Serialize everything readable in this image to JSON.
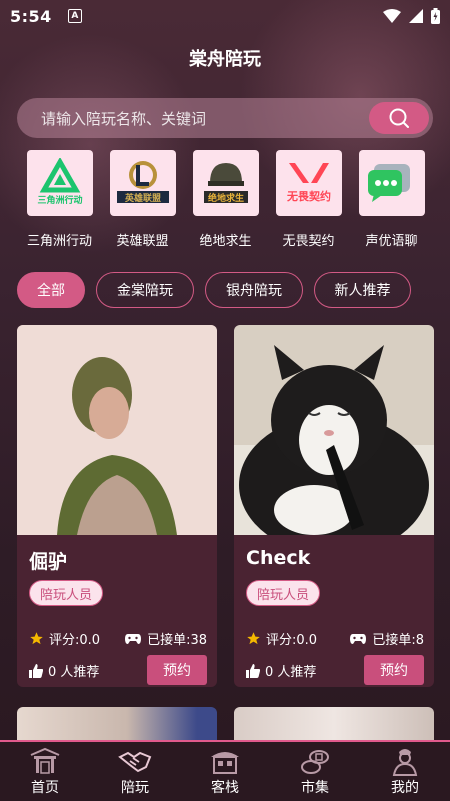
{
  "status": {
    "time": "5:54",
    "notif_letter": "A"
  },
  "app": {
    "title": "棠舟陪玩"
  },
  "search": {
    "placeholder": "请输入陪玩名称、关键词"
  },
  "games": [
    {
      "label": "三角洲行动",
      "logo_text": "三角洲行动"
    },
    {
      "label": "英雄联盟",
      "logo_text": "英雄联盟"
    },
    {
      "label": "绝地求生",
      "logo_text": "绝地求生"
    },
    {
      "label": "无畏契约",
      "logo_text": "无畏契约"
    },
    {
      "label": "声优语聊",
      "logo_text": ""
    }
  ],
  "filters": [
    {
      "label": "全部",
      "active": true
    },
    {
      "label": "金棠陪玩",
      "active": false
    },
    {
      "label": "银舟陪玩",
      "active": false
    },
    {
      "label": "新人推荐",
      "active": false
    }
  ],
  "cards": [
    {
      "name": "倔驴",
      "role": "陪玩人员",
      "rating": "评分:0.0",
      "orders": "已接单:38",
      "recommend": "0 人推荐",
      "book": "预约"
    },
    {
      "name": "Check",
      "role": "陪玩人员",
      "rating": "评分:0.0",
      "orders": "已接单:8",
      "recommend": "0 人推荐",
      "book": "预约"
    }
  ],
  "tabs": [
    {
      "label": "首页",
      "icon": "gate-icon"
    },
    {
      "label": "陪玩",
      "icon": "handshake-icon"
    },
    {
      "label": "客栈",
      "icon": "inn-icon"
    },
    {
      "label": "市集",
      "icon": "coins-icon"
    },
    {
      "label": "我的",
      "icon": "person-icon"
    }
  ],
  "colors": {
    "accent": "#d35a85",
    "card": "#4a2332",
    "badge_bg": "#fbe3ec"
  }
}
